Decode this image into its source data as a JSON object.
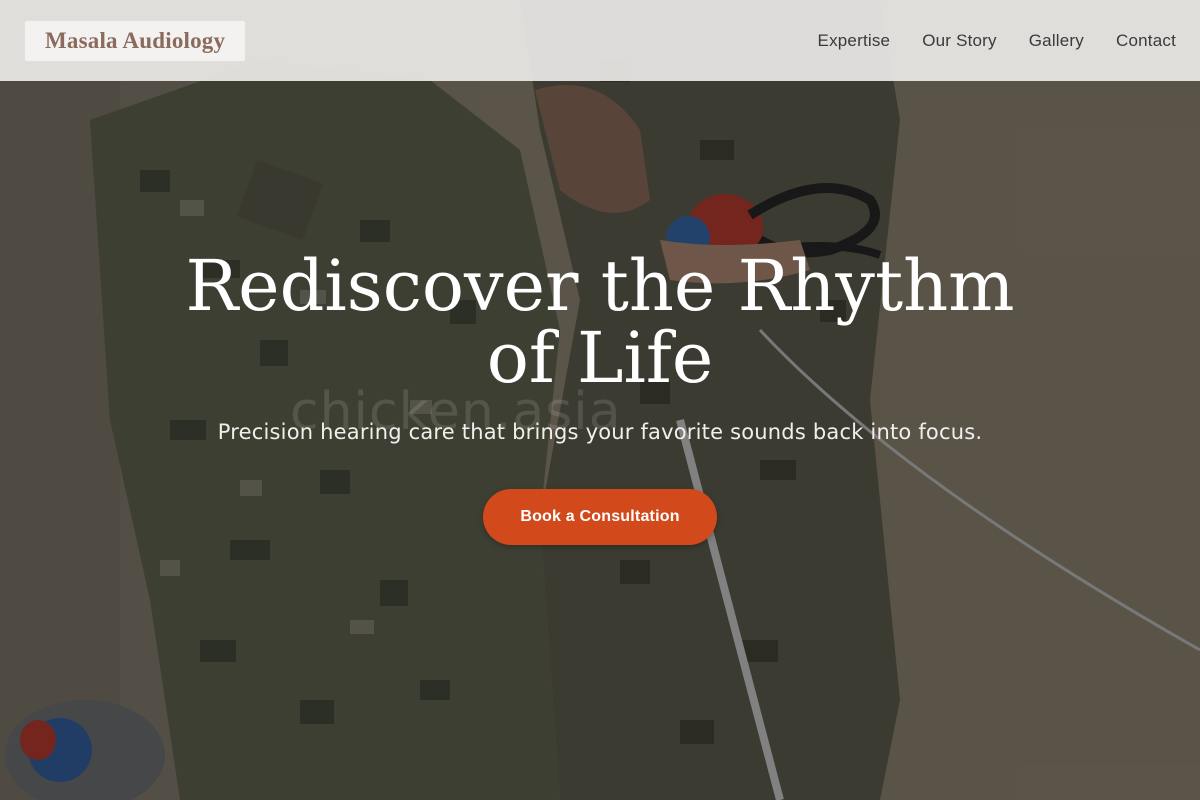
{
  "brand": {
    "name": "Masala Audiology"
  },
  "nav": {
    "items": [
      {
        "label": "Expertise"
      },
      {
        "label": "Our Story"
      },
      {
        "label": "Gallery"
      },
      {
        "label": "Contact"
      }
    ]
  },
  "hero": {
    "headline": "Rediscover the Rhythm of Life",
    "subheadline": "Precision hearing care that brings your favorite sounds back into focus.",
    "cta_label": "Book a Consultation",
    "watermark": "chicken.asia",
    "photo_icon": "hero-photo-audiometry"
  },
  "colors": {
    "accent": "#d24a1c",
    "brand_text": "#8a6b5c",
    "header_bg": "#eceae8"
  }
}
